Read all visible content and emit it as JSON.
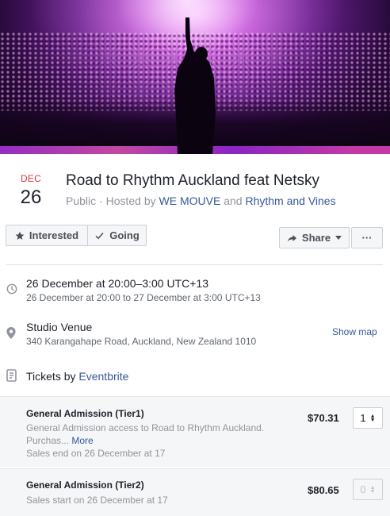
{
  "header": {
    "month": "DEC",
    "day": "26",
    "title": "Road to Rhythm Auckland feat Netsky",
    "privacy": "Public",
    "hosted_by_prefix": "Hosted by",
    "host1": "WE MOUVE",
    "and": "and",
    "host2": "Rhythm and Vines"
  },
  "actions": {
    "interested": "Interested",
    "going": "Going",
    "share": "Share",
    "more": "···"
  },
  "time": {
    "main": "26 December at 20:00–3:00 UTC+13",
    "sub": "26 December at 20:00 to 27 December at 3:00 UTC+13"
  },
  "venue": {
    "name": "Studio Venue",
    "address": "340 Karangahape Road, Auckland, New Zealand 1010",
    "show_map": "Show map"
  },
  "tickets": {
    "prefix": "Tickets by",
    "provider": "Eventbrite",
    "tiers": [
      {
        "name": "General Admission (Tier1)",
        "desc_line1": "General Admission access to Road to Rhythm Auckland.",
        "desc_line2": "Purchas...",
        "more": "More",
        "sales": "Sales end on 26 December at 17",
        "price": "$70.31",
        "qty": "1"
      },
      {
        "name": "General Admission (Tier2)",
        "sales": "Sales start on 26 December at 17",
        "price": "$80.65",
        "qty": "0"
      }
    ]
  },
  "colors": {
    "month_red": "#e0393e",
    "link_blue": "#365899",
    "muted_gray": "#90949c"
  },
  "icons": {
    "interested": "star-icon",
    "going": "check-icon",
    "share": "share-arrow-icon",
    "time": "clock-icon",
    "venue": "map-pin-icon",
    "tickets": "ticket-icon"
  }
}
